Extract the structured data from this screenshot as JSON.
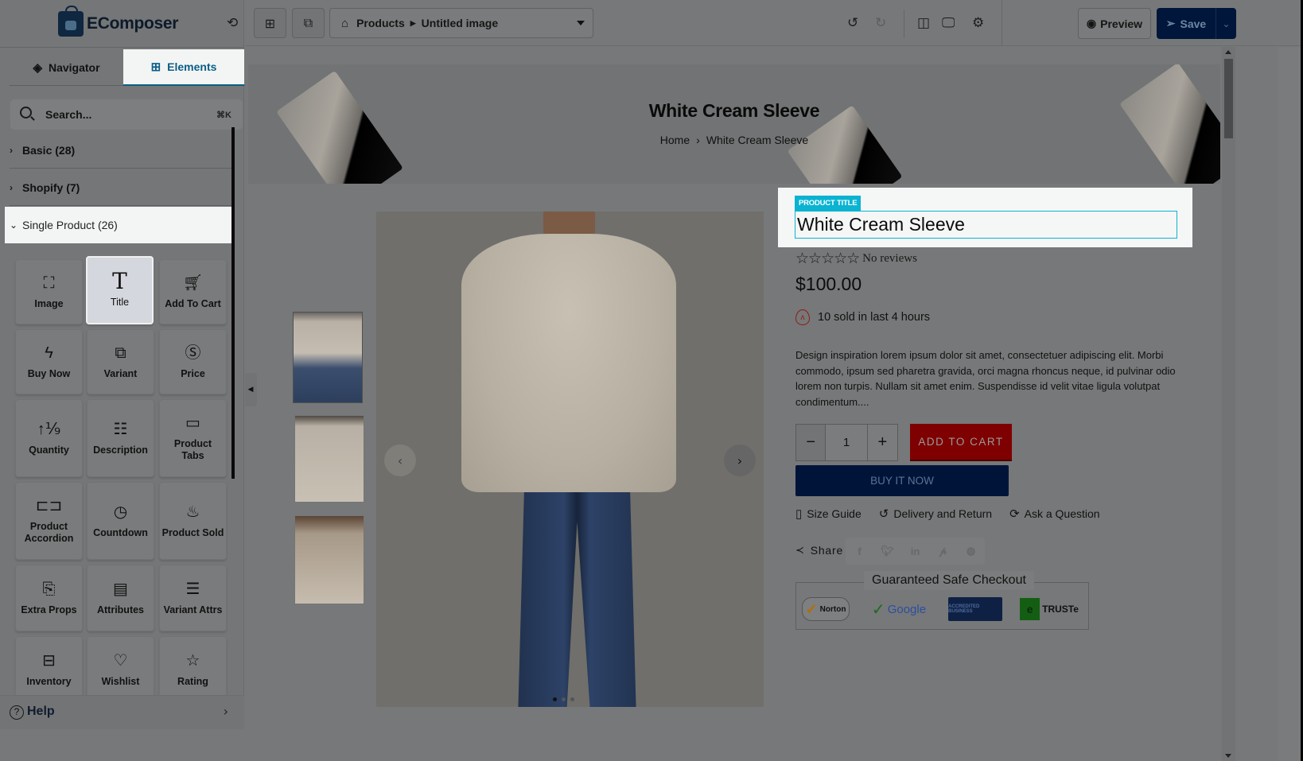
{
  "app": {
    "name": "EComposer"
  },
  "sidebar": {
    "tabs": [
      {
        "label": "Navigator",
        "icon": "layers-icon",
        "active": false
      },
      {
        "label": "Elements",
        "icon": "grid-plus-icon",
        "active": true
      }
    ],
    "search": {
      "placeholder": "Search...",
      "shortcut": "⌘K"
    },
    "categories": [
      {
        "label": "Basic (28)",
        "expanded": false
      },
      {
        "label": "Shopify (7)",
        "expanded": false
      },
      {
        "label": "Single Product (26)",
        "expanded": true
      }
    ],
    "elements": [
      {
        "label": "Image",
        "icon": "image-icon",
        "glyph": "🖼"
      },
      {
        "label": "Title",
        "icon": "title-icon",
        "glyph": "T",
        "active": true
      },
      {
        "label": "Add To Cart",
        "icon": "cart-icon",
        "glyph": "🛒"
      },
      {
        "label": "Buy Now",
        "icon": "lightning-icon",
        "glyph": "ϟ"
      },
      {
        "label": "Variant",
        "icon": "swatch-icon",
        "glyph": "▥"
      },
      {
        "label": "Price",
        "icon": "dollar-icon",
        "glyph": "$"
      },
      {
        "label": "Quantity",
        "icon": "quantity-icon",
        "glyph": "↑⅑"
      },
      {
        "label": "Description",
        "icon": "document-icon",
        "glyph": "≣"
      },
      {
        "label": "Product Tabs",
        "icon": "tabs-icon",
        "glyph": "▭"
      },
      {
        "label": "Product Accordion",
        "icon": "accordion-icon",
        "glyph": "⊏⊐"
      },
      {
        "label": "Countdown",
        "icon": "timer-icon",
        "glyph": "◷"
      },
      {
        "label": "Product Sold",
        "icon": "fire-icon",
        "glyph": "♨"
      },
      {
        "label": "Extra Props",
        "icon": "file-plus-icon",
        "glyph": "🗋"
      },
      {
        "label": "Attributes",
        "icon": "file-info-icon",
        "glyph": "🗎"
      },
      {
        "label": "Variant Attrs",
        "icon": "list-icon",
        "glyph": "☰"
      },
      {
        "label": "Inventory",
        "icon": "archive-icon",
        "glyph": "🗃"
      },
      {
        "label": "Wishlist",
        "icon": "heart-icon",
        "glyph": "♡"
      },
      {
        "label": "Rating",
        "icon": "star-sparkle-icon",
        "glyph": "☆"
      }
    ],
    "help_label": "Help"
  },
  "topbar": {
    "breadcrumb": {
      "parent": "Products",
      "current": "Untitled image"
    },
    "preview_label": "Preview",
    "save_label": "Save"
  },
  "page": {
    "hero": {
      "title": "White Cream Sleeve",
      "breadcrumb_home": "Home",
      "breadcrumb_current": "White Cream Sleeve"
    },
    "selection_badge": "PRODUCT TITLE",
    "product": {
      "title": "White Cream Sleeve",
      "rating_stars": 0,
      "rating_max": 5,
      "reviews_text": "No reviews",
      "price": "$100.00",
      "sold_text": "10 sold in last 4 hours",
      "description": "Design inspiration lorem ipsum dolor sit amet, consectetuer adipiscing elit. Morbi commodo, ipsum sed pharetra gravida, orci magna rhoncus neque, id pulvinar odio lorem non turpis. Nullam sit amet enim. Suspendisse id velit vitae ligula volutpat condimentum....",
      "quantity": "1",
      "add_to_cart_label": "ADD TO CART",
      "buy_now_label": "BUY IT NOW",
      "links": [
        {
          "label": "Size Guide",
          "icon": "ruler-book-icon"
        },
        {
          "label": "Delivery and Return",
          "icon": "return-icon"
        },
        {
          "label": "Ask a Question",
          "icon": "refresh-icon"
        }
      ],
      "share_label": "Share",
      "socials": [
        "facebook",
        "twitter",
        "linkedin",
        "pinterest",
        "reddit"
      ],
      "trust_title": "Guaranteed Safe Checkout",
      "trust_badges": [
        "Norton Secured",
        "Google Trusted Store",
        "BBB Accredited Business",
        "TRUSTe Certified Privacy"
      ]
    },
    "gallery": {
      "thumbnail_count": 3,
      "active_index": 0,
      "dot_count": 3
    }
  },
  "colors": {
    "accent": "#0bb3d2",
    "brand_navy": "#00163a",
    "add_to_cart": "#7e0000",
    "active_tab": "#0b5e86"
  }
}
